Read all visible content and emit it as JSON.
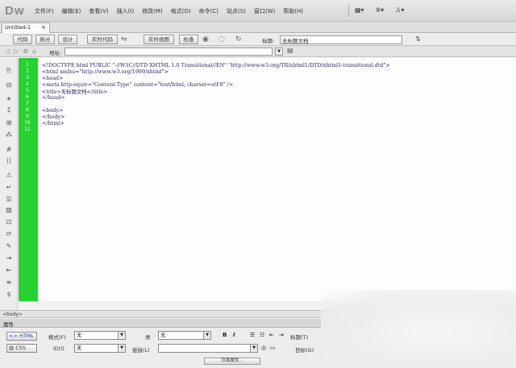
{
  "app": {
    "logo": "Dw"
  },
  "menu": {
    "items": [
      "文件(F)",
      "编辑(E)",
      "查看(V)",
      "插入(I)",
      "修改(M)",
      "格式(O)",
      "命令(C)",
      "站点(S)",
      "窗口(W)",
      "帮助(H)"
    ],
    "tools": [
      "▦▾",
      "✲▾",
      "♙▾"
    ]
  },
  "document": {
    "tab_label": "Untitled-1",
    "close": "×"
  },
  "doc_toolbar": {
    "code": "代码",
    "split": "拆分",
    "design": "设计",
    "live_code": "实时代码",
    "live_view": "实时视图",
    "inspect": "检查",
    "title_label": "标题:",
    "title_value": "无标题文档"
  },
  "address": {
    "label": "地址:",
    "value": ""
  },
  "code": {
    "line_numbers": [
      "1",
      "2",
      "3",
      "4",
      "5",
      "6",
      "7",
      "8",
      "9",
      "10",
      "11"
    ],
    "lines": [
      "<!DOCTYPE html PUBLIC \"-//W3C//DTD XHTML 1.0 Transitional//EN\" \"http://www.w3.org/TR/xhtml1/DTD/xhtml1-transitional.dtd\">",
      "<html xmlns=\"http://www.w3.org/1999/xhtml\">",
      "<head>",
      "<meta http-equiv=\"Content-Type\" content=\"text/html; charset=utf-8\" />",
      "<title>无标题文档</title>",
      "</head>",
      "",
      "<body>",
      "</body>",
      "</html>",
      ""
    ]
  },
  "tag_selector": {
    "tag": "<body>"
  },
  "properties": {
    "header": "属性",
    "html_button": "<> HTML",
    "css_button": "CSS",
    "format_label": "格式(F)",
    "format_value": "无",
    "class_label": "类",
    "class_value": "无",
    "id_label": "ID(I)",
    "id_value": "无",
    "link_label": "链接(L)",
    "bold": "B",
    "italic": "I",
    "title_label": "标题(T)",
    "target_label": "目标(G)",
    "page_props_button": "页面属性..."
  }
}
